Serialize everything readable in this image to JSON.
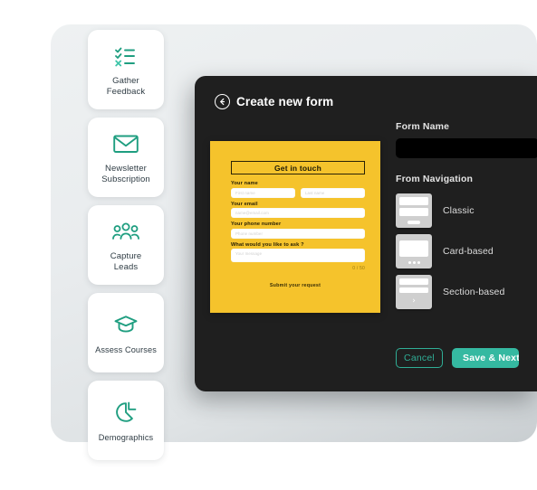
{
  "sidebar": {
    "items": [
      {
        "label": "Gather\nFeedback",
        "icon": "checklist-icon"
      },
      {
        "label": "Newsletter\nSubscription",
        "icon": "envelope-icon"
      },
      {
        "label": "Capture\nLeads",
        "icon": "people-group-icon"
      },
      {
        "label": "Assess Courses",
        "icon": "graduation-cap-icon"
      },
      {
        "label": "Demographics",
        "icon": "pie-chart-icon"
      }
    ]
  },
  "panel": {
    "title": "Create new form",
    "back_icon": "back-arrow-icon"
  },
  "preview": {
    "title": "Get in touch",
    "fields": [
      {
        "label": "Your name",
        "placeholders": [
          "First name",
          "Last name"
        ]
      },
      {
        "label": "Your email",
        "placeholders": [
          "name@email.com"
        ]
      },
      {
        "label": "Your phone number",
        "placeholders": [
          "Phone number"
        ]
      },
      {
        "label": "What would you like to ask ?",
        "placeholders": [
          "Your message"
        ]
      }
    ],
    "counter": "0 / 50",
    "submit_label": "Submit your request"
  },
  "settings": {
    "form_name_label": "Form Name",
    "form_name_value": "",
    "navigation_label": "From Navigation",
    "navigation_options": [
      {
        "name": "Classic",
        "thumb": "classic"
      },
      {
        "name": "Card-based",
        "thumb": "card-based"
      },
      {
        "name": "Section-based",
        "thumb": "section-based"
      }
    ]
  },
  "actions": {
    "cancel_label": "Cancel",
    "save_label": "Save & Next"
  },
  "colors": {
    "accent_teal": "#35b9a1",
    "form_yellow": "#F5C32C",
    "panel_dark": "#1f1f1f",
    "icon_green": "#1f9e80"
  }
}
